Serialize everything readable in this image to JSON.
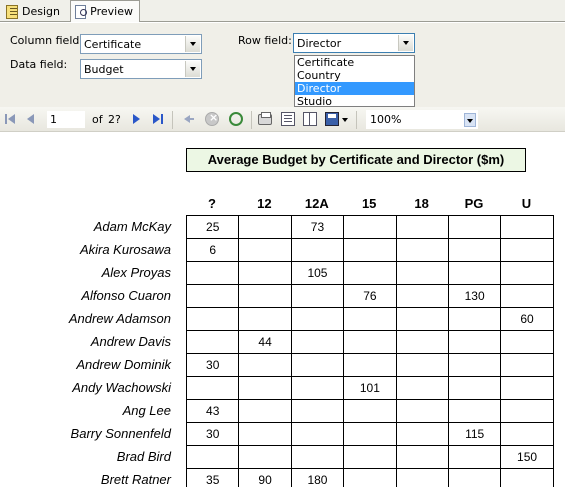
{
  "tabs": [
    {
      "label": "Design",
      "icon": "design-icon"
    },
    {
      "label": "Preview",
      "icon": "preview-icon"
    }
  ],
  "settings": {
    "column_field_label": "Column field:",
    "column_field_value": "Certificate",
    "data_field_label": "Data field:",
    "data_field_value": "Budget",
    "row_field_label": "Row field:",
    "row_field_value": "Director",
    "row_field_options": [
      "Certificate",
      "Country",
      "Director",
      "Studio"
    ],
    "row_field_selected": "Director"
  },
  "toolbar": {
    "page_current": "1",
    "page_of": "of",
    "page_total": "2?",
    "zoom": "100%"
  },
  "report": {
    "title": "Average Budget by Certificate and Director ($m)",
    "columns": [
      "?",
      "12",
      "12A",
      "15",
      "18",
      "PG",
      "U"
    ],
    "rows": [
      {
        "name": "Adam McKay",
        "values": [
          "25",
          "",
          "73",
          "",
          "",
          "",
          ""
        ]
      },
      {
        "name": "Akira Kurosawa",
        "values": [
          "6",
          "",
          "",
          "",
          "",
          "",
          ""
        ]
      },
      {
        "name": "Alex Proyas",
        "values": [
          "",
          "",
          "105",
          "",
          "",
          "",
          ""
        ]
      },
      {
        "name": "Alfonso Cuaron",
        "values": [
          "",
          "",
          "",
          "76",
          "",
          "130",
          ""
        ]
      },
      {
        "name": "Andrew Adamson",
        "values": [
          "",
          "",
          "",
          "",
          "",
          "",
          "60"
        ]
      },
      {
        "name": "Andrew Davis",
        "values": [
          "",
          "44",
          "",
          "",
          "",
          "",
          ""
        ]
      },
      {
        "name": "Andrew Dominik",
        "values": [
          "30",
          "",
          "",
          "",
          "",
          "",
          ""
        ]
      },
      {
        "name": "Andy Wachowski",
        "values": [
          "",
          "",
          "",
          "101",
          "",
          "",
          ""
        ]
      },
      {
        "name": "Ang Lee",
        "values": [
          "43",
          "",
          "",
          "",
          "",
          "",
          ""
        ]
      },
      {
        "name": "Barry Sonnenfeld",
        "values": [
          "30",
          "",
          "",
          "",
          "",
          "115",
          ""
        ]
      },
      {
        "name": "Brad Bird",
        "values": [
          "",
          "",
          "",
          "",
          "",
          "",
          "150"
        ]
      },
      {
        "name": "Brett Ratner",
        "values": [
          "35",
          "90",
          "180",
          "",
          "",
          "",
          ""
        ]
      }
    ]
  },
  "colors": {
    "title_bg": "#ecf7e4",
    "selection": "#3399ff",
    "panel_bg": "#f0efe8"
  }
}
